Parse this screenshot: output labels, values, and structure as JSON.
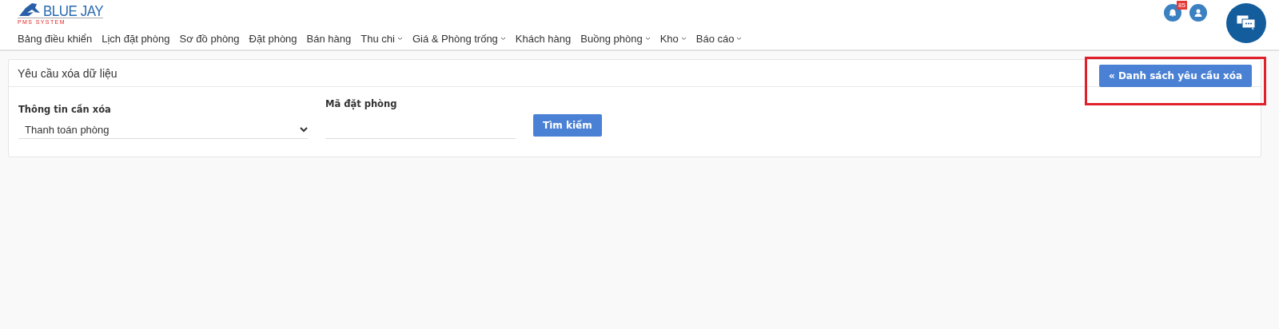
{
  "logo": {
    "name": "BLUE JAY",
    "tagline": "PMS SYSTEM"
  },
  "nav": [
    {
      "label": "Bảng điều khiển",
      "dropdown": false
    },
    {
      "label": "Lịch đặt phòng",
      "dropdown": false
    },
    {
      "label": "Sơ đồ phòng",
      "dropdown": false
    },
    {
      "label": "Đặt phòng",
      "dropdown": false
    },
    {
      "label": "Bán hàng",
      "dropdown": false
    },
    {
      "label": "Thu chi",
      "dropdown": true
    },
    {
      "label": "Giá & Phòng trống",
      "dropdown": true
    },
    {
      "label": "Khách hàng",
      "dropdown": false
    },
    {
      "label": "Buồng phòng",
      "dropdown": true
    },
    {
      "label": "Kho",
      "dropdown": true
    },
    {
      "label": "Báo cáo",
      "dropdown": true
    }
  ],
  "notifications": {
    "count": "85"
  },
  "card": {
    "title": "Yêu cầu xóa dữ liệu",
    "list_button": {
      "label": "« Danh sách yêu cầu xóa",
      "highlighted": true
    },
    "fields": [
      {
        "kind": "select",
        "label": "Thông tin cần xóa",
        "value": "Thanh toán phòng"
      },
      {
        "kind": "text",
        "label": "Mã đặt phòng"
      }
    ],
    "search_button": "Tìm kiếm"
  }
}
